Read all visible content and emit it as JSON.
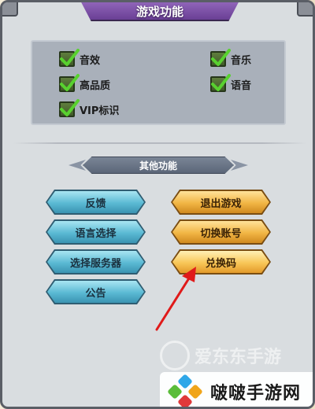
{
  "header": {
    "title": "游戏功能"
  },
  "settings": {
    "items": [
      {
        "label": "音效",
        "checked": true
      },
      {
        "label": "音乐",
        "checked": true
      },
      {
        "label": "高品质",
        "checked": true
      },
      {
        "label": "语音",
        "checked": true
      },
      {
        "label": "VIP标识",
        "checked": true
      }
    ]
  },
  "other": {
    "title": "其他功能",
    "left_buttons": [
      "反馈",
      "语言选择",
      "选择服务器",
      "公告"
    ],
    "right_buttons": [
      "退出游戏",
      "切换账号",
      "兑换码"
    ]
  },
  "watermark": {
    "top_text": "爱东东手游",
    "bottom_text": "啵啵手游网"
  },
  "colors": {
    "header_purple": "#7a4ea8",
    "check_green": "#49b82c",
    "button_blue": "#5ab9d3",
    "button_gold": "#f1b544",
    "arrow_red": "#e01a1a"
  }
}
